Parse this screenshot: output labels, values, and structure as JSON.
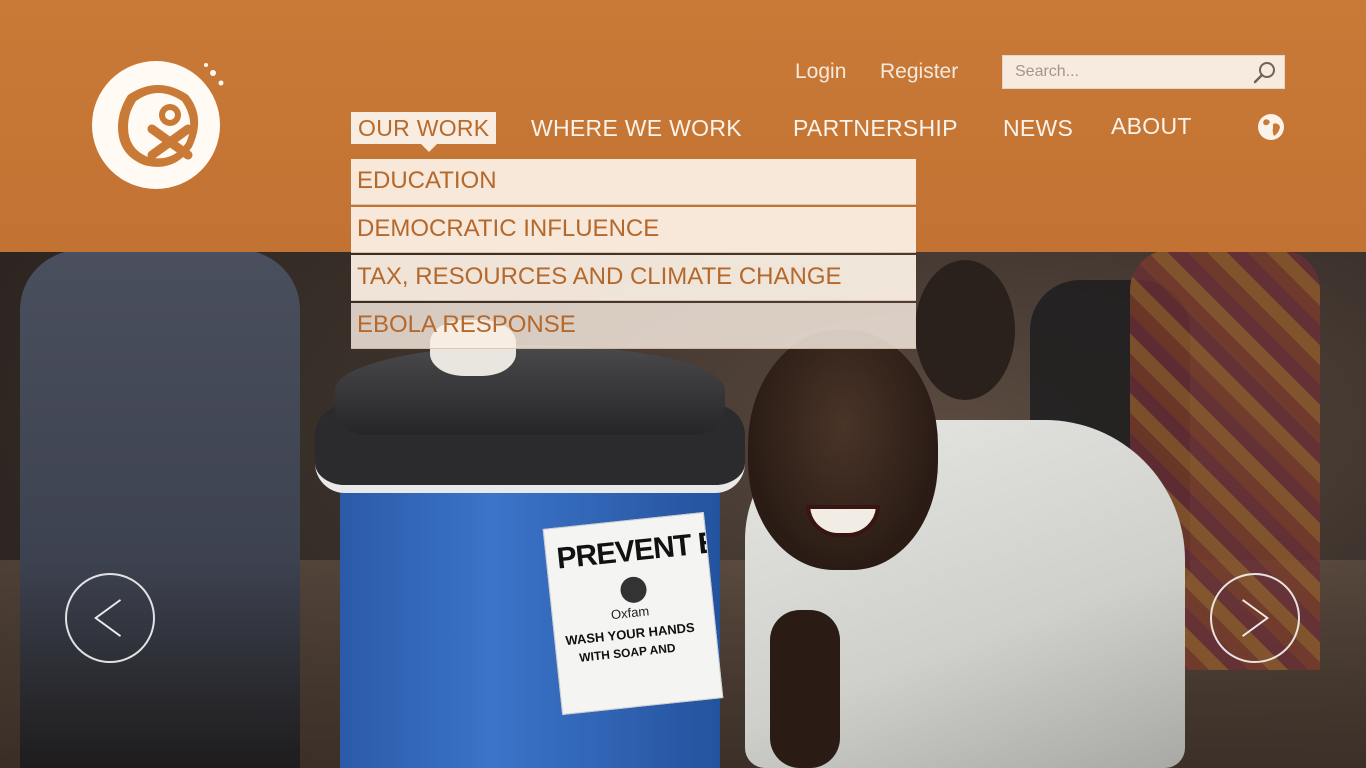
{
  "header": {
    "login_label": "Login",
    "register_label": "Register",
    "search": {
      "placeholder": "Search..."
    }
  },
  "nav": {
    "items": [
      {
        "label": "OUR WORK",
        "active": true
      },
      {
        "label": "WHERE WE WORK"
      },
      {
        "label": "PARTNERSHIP"
      },
      {
        "label": "NEWS"
      },
      {
        "label": "ABOUT"
      }
    ],
    "language_icon": "globe-icon"
  },
  "dropdown": {
    "items": [
      {
        "label": "EDUCATION"
      },
      {
        "label": "DEMOCRATIC INFLUENCE"
      },
      {
        "label": "TAX, RESOURCES AND CLIMATE CHANGE"
      },
      {
        "label": "EBOLA RESPONSE"
      }
    ]
  },
  "hero": {
    "bucket_label": {
      "line1": "PREVENT EBO",
      "line2": "Oxfam",
      "line3": "WASH YOUR HANDS",
      "line4": "WITH SOAP AND"
    },
    "prev_icon": "chevron-left-icon",
    "next_icon": "chevron-right-icon"
  },
  "colors": {
    "header_bg": "#c97a37",
    "dropdown_bg": "#faeee3",
    "accent_text": "#b4682c",
    "nav_text": "#fbf3ea"
  }
}
